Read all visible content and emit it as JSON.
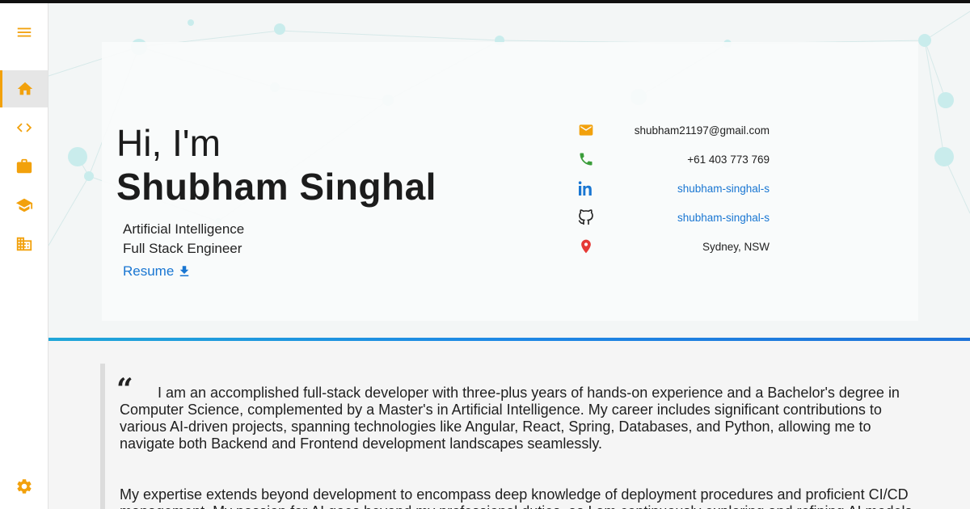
{
  "sidebar": {
    "items": [
      {
        "name": "menu",
        "icon": "hamburger-menu-icon"
      },
      {
        "name": "home",
        "icon": "home-icon",
        "active": true
      },
      {
        "name": "code",
        "icon": "code-icon"
      },
      {
        "name": "experience",
        "icon": "briefcase-icon"
      },
      {
        "name": "education",
        "icon": "graduation-cap-icon"
      },
      {
        "name": "organization",
        "icon": "building-icon"
      },
      {
        "name": "settings",
        "icon": "gear-icon"
      }
    ]
  },
  "hero": {
    "greeting": "Hi, I'm",
    "name": "Shubham Singhal",
    "role_line1": "Artificial Intelligence",
    "role_line2": "Full Stack Engineer",
    "resume_label": "Resume"
  },
  "contact": {
    "email": "shubham21197@gmail.com",
    "phone": "+61 403 773 769",
    "linkedin": "shubham-singhal-s",
    "github": "shubham-singhal-s",
    "location": "Sydney, NSW"
  },
  "about": {
    "quote_mark": "“",
    "paragraph1": "I am an accomplished full-stack developer with three-plus years of hands-on experience and a Bachelor's degree in Computer Science, complemented by a Master's in Artificial Intelligence. My career includes significant contributions to various AI-driven projects, spanning technologies like Angular, React, Spring, Databases, and Python, allowing me to navigate both Backend and Frontend development landscapes seamlessly.",
    "paragraph2": "My expertise extends beyond development to encompass deep knowledge of deployment procedures and proficient CI/CD management. My passion for AI goes beyond my professional duties, as I am continuously exploring and refining AI models."
  },
  "colors": {
    "accent": "#f2a10c",
    "link": "#1976d2",
    "divider": "#1e88e5",
    "email_icon": "#f2a10c",
    "phone_icon": "#3a9d3a",
    "linkedin_icon": "#1976d2",
    "github_icon": "#222222",
    "location_icon": "#e53935"
  }
}
